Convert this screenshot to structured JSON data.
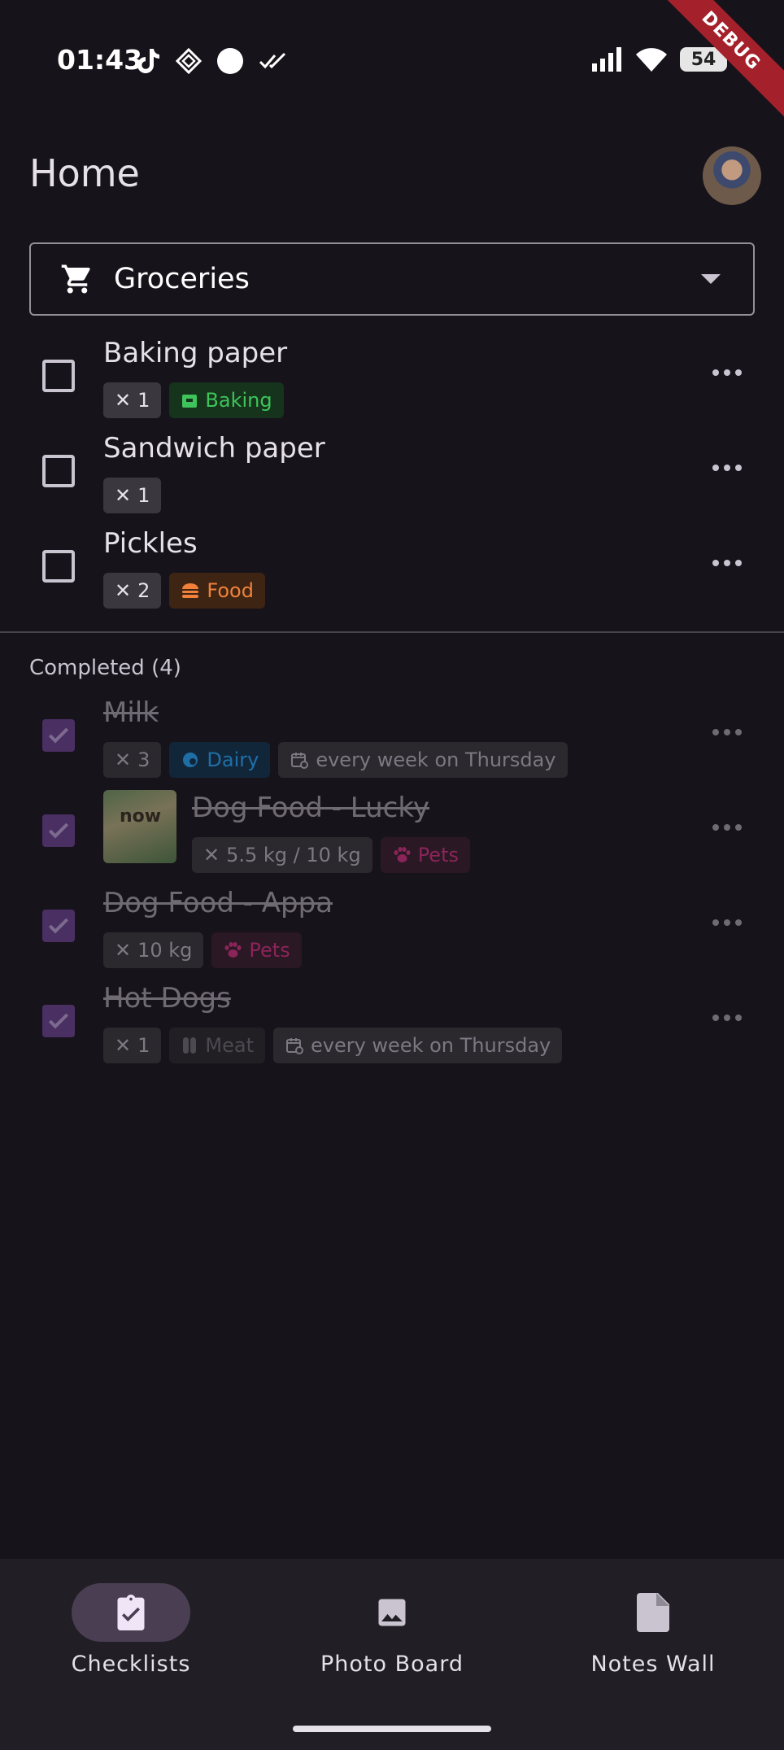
{
  "status_bar": {
    "time": "01:43",
    "battery": "54"
  },
  "debug_banner": "DEBUG",
  "header": {
    "title": "Home"
  },
  "list_selector": {
    "value": "Groceries"
  },
  "active_items": [
    {
      "title": "Baking paper",
      "qty": "1",
      "category": "Baking"
    },
    {
      "title": "Sandwich paper",
      "qty": "1"
    },
    {
      "title": "Pickles",
      "qty": "2",
      "category": "Food"
    }
  ],
  "completed": {
    "header": "Completed (4)",
    "items": [
      {
        "title": "Milk",
        "qty": "3",
        "category": "Dairy",
        "recurrence": "every week on Thursday"
      },
      {
        "title": "Dog Food - Lucky",
        "qty": "5.5 kg / 10 kg",
        "category": "Pets",
        "thumb_text": "now"
      },
      {
        "title": "Dog Food - Appa",
        "qty": "10 kg",
        "category": "Pets"
      },
      {
        "title": "Hot Dogs",
        "qty": "1",
        "category": "Meat",
        "recurrence": "every week on Thursday"
      }
    ]
  },
  "nav": {
    "checklists": "Checklists",
    "photo_board": "Photo Board",
    "notes_wall": "Notes Wall"
  },
  "colors": {
    "background": "#17131a",
    "accent": "#4a2f63",
    "baking": "#3ec45a",
    "food": "#f1813a",
    "dairy": "#1f6fa7",
    "pets": "#8b2459"
  }
}
